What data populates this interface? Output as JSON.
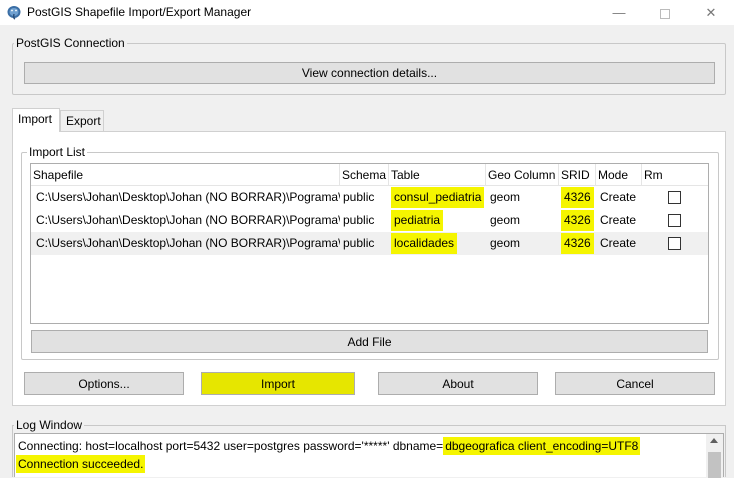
{
  "window": {
    "title": "PostGIS Shapefile Import/Export Manager",
    "minimize_glyph": "—",
    "close_glyph": "✕"
  },
  "connection": {
    "group_label": "PostGIS Connection",
    "view_details_label": "View connection details..."
  },
  "tabs": [
    {
      "label": "Import",
      "active": true
    },
    {
      "label": "Export",
      "active": false
    }
  ],
  "import_list": {
    "group_label": "Import List",
    "columns": [
      "Shapefile",
      "Schema",
      "Table",
      "Geo Column",
      "SRID",
      "Mode",
      "Rm"
    ],
    "rows": [
      {
        "shapefile": "C:\\Users\\Johan\\Desktop\\Johan (NO BORRAR)\\Pograma\\QGIS\\CAPAS\\consul_pediatria.shp",
        "schema": "public",
        "table": "consul_pediatria",
        "geo_column": "geom",
        "srid": "4326",
        "mode": "Create",
        "rm": false
      },
      {
        "shapefile": "C:\\Users\\Johan\\Desktop\\Johan (NO BORRAR)\\Pograma\\QGIS\\CAPAS\\pediatria.shp",
        "schema": "public",
        "table": "pediatria",
        "geo_column": "geom",
        "srid": "4326",
        "mode": "Create",
        "rm": false
      },
      {
        "shapefile": "C:\\Users\\Johan\\Desktop\\Johan (NO BORRAR)\\Pograma\\QGIS\\CAPAS\\localidades.shp",
        "schema": "public",
        "table": "localidades",
        "geo_column": "geom",
        "srid": "4326",
        "mode": "Create",
        "rm": false
      }
    ],
    "add_file_label": "Add File"
  },
  "actions": {
    "options_label": "Options...",
    "import_label": "Import",
    "about_label": "About",
    "cancel_label": "Cancel"
  },
  "log": {
    "group_label": "Log Window",
    "line1_prefix": "Connecting:  host=localhost port=5432 user=postgres password='*****' dbname=",
    "line1_highlight": "dbgeografica client_encoding=UTF8",
    "line2": "Connection succeeded."
  },
  "colors": {
    "highlight": "#f5f500",
    "button_highlight": "#e6e600",
    "window_bg": "#f0f0f0"
  }
}
